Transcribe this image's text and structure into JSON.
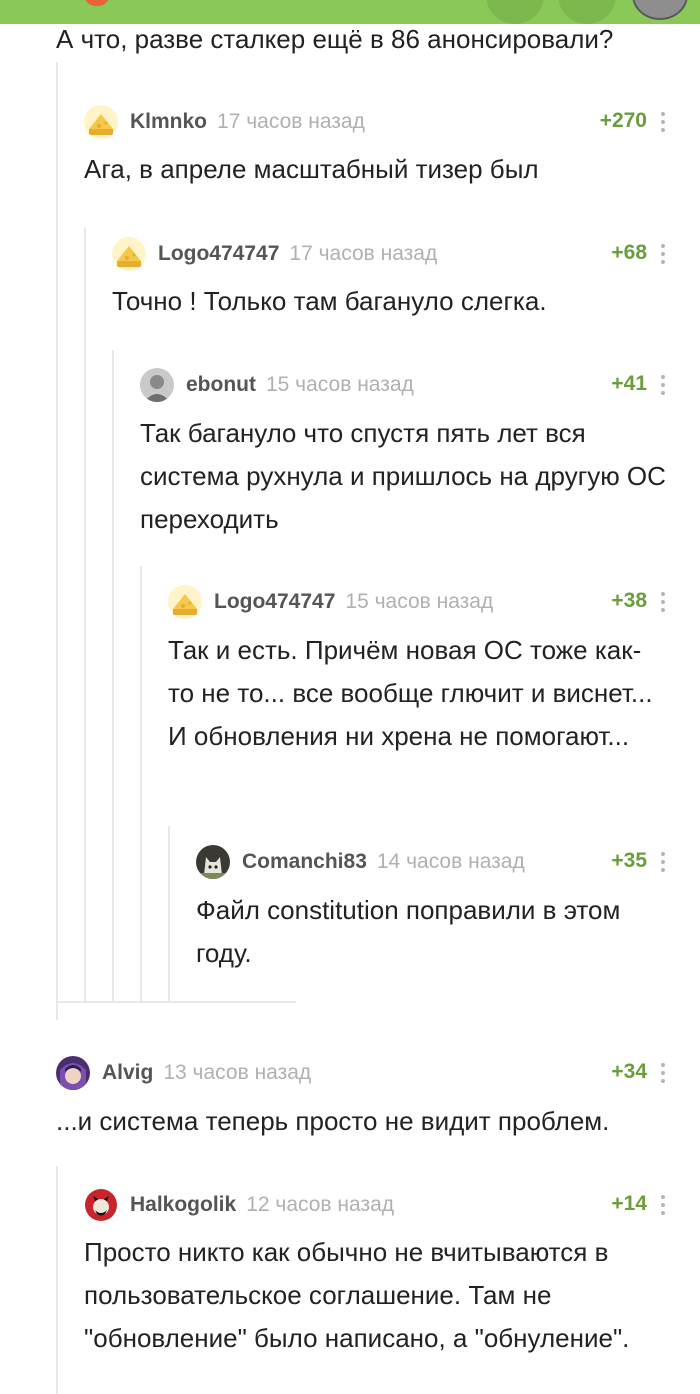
{
  "parent_comment": {
    "text": "А что, разве сталкер ещё в 86 анонсировали?"
  },
  "comments": [
    {
      "author": "Klmnko",
      "time": "17 часов назад",
      "score": "+270",
      "text": "Ага, в апреле масштабный тизер был",
      "avatar": "cheese-avatar"
    },
    {
      "author": "Logo474747",
      "time": "17 часов назад",
      "score": "+68",
      "text": "Точно ! Только там багануло слегка.",
      "avatar": "cheese-avatar"
    },
    {
      "author": "ebonut",
      "time": "15 часов назад",
      "score": "+41",
      "text": "Так баганулo что спустя пять лет вся система рухнула и пришлось на другую ОС переходить",
      "avatar": "photo-avatar"
    },
    {
      "author": "Logo474747",
      "time": "15 часов назад",
      "score": "+38",
      "text": "Так и есть. Причём новая ОС тоже как-то не то... все вообще глючит и виснет... И обновления ни хрена не помогают...",
      "avatar": "cheese-avatar"
    },
    {
      "author": "Comanchi83",
      "time": "14 часов назад",
      "score": "+35",
      "text": "Файл constitution поправили в этом году.",
      "avatar": "cat-avatar"
    },
    {
      "author": "Alvig",
      "time": "13 часов назад",
      "score": "+34",
      "text": "...и система теперь просто не видит проблем.",
      "avatar": "anime-avatar"
    },
    {
      "author": "Halkogolik",
      "time": "12 часов назад",
      "score": "+14",
      "text": "Просто никто как обычно не вчитываются в пользовательское соглашение. Там не \"обновление\" было написано, а \"обнуление\".",
      "avatar": "devil-avatar"
    }
  ],
  "colors": {
    "brand_green": "#8ac858",
    "score_green": "#6a9e3c",
    "thread_line": "#e8e8e8"
  }
}
